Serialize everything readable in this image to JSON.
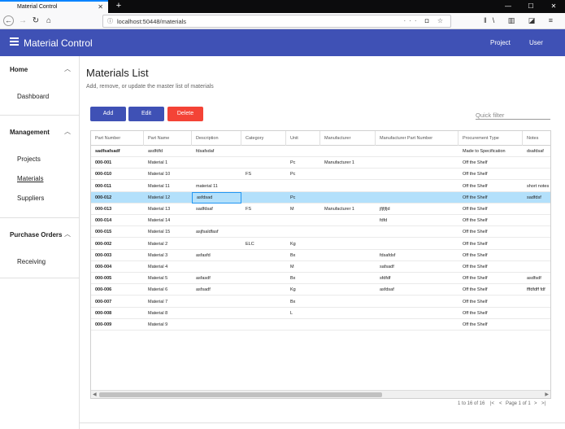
{
  "browser": {
    "tab_title": "Material Control",
    "new_tab": "+",
    "url": "localhost:50448/materials",
    "url_actions": "··· ◘ ☆",
    "toolbar_icons": "‖\\ ▥ ◪ ≡"
  },
  "app": {
    "title": "Material Control",
    "nav": [
      "Project",
      "User"
    ]
  },
  "sidebar": {
    "sections": [
      {
        "title": "Home",
        "items": [
          "Dashboard"
        ]
      },
      {
        "title": "Management",
        "items": [
          "Projects",
          "Materials",
          "Suppliers"
        ]
      },
      {
        "title": "Purchase Orders",
        "items": [
          "Receiving"
        ]
      }
    ]
  },
  "page": {
    "title": "Materials List",
    "subtitle": "Add, remove, or update the master list of materials",
    "buttons": {
      "add": "Add",
      "edit": "Edit",
      "delete": "Delete"
    },
    "quick_filter_placeholder": "Quick filter"
  },
  "grid": {
    "columns": [
      "Part Number",
      "Part Name",
      "Description",
      "Category",
      "Unit",
      "Manufacturer",
      "Manufacturer Part Number",
      "Procurement Type",
      "Notes"
    ],
    "selected_row": 4,
    "focused_cell": [
      4,
      2
    ],
    "rows": [
      [
        "sadfsafsadf",
        "asdfdfd",
        "fdsafsdaf",
        "",
        "",
        "",
        "",
        "Made to Specification",
        "dsafdsaf"
      ],
      [
        "000-001",
        "Material 1",
        "",
        "",
        "Pc",
        "Manufacturer 1",
        "",
        "Off the Shelf",
        ""
      ],
      [
        "000-010",
        "Material 10",
        "",
        "FS",
        "Pc",
        "",
        "",
        "Off the Shelf",
        ""
      ],
      [
        "000-011",
        "Material 11",
        "material 11",
        "",
        "",
        "",
        "",
        "Off the Shelf",
        "short notes"
      ],
      [
        "000-012",
        "Material 12",
        "asfdsad",
        "",
        "Pc",
        "",
        "",
        "Off the Shelf",
        "sadfdsf"
      ],
      [
        "000-013",
        "Material 13",
        "sadfdsaf",
        "FS",
        "M",
        "Manufacturer 1",
        "jfjfjfjd",
        "Off the Shelf",
        ""
      ],
      [
        "000-014",
        "Material 14",
        "",
        "",
        "",
        "",
        "fdfd",
        "Off the Shelf",
        ""
      ],
      [
        "000-015",
        "Material 15",
        "asjfsaldfasf",
        "",
        "",
        "",
        "",
        "Off the Shelf",
        ""
      ],
      [
        "000-002",
        "Material 2",
        "",
        "ELC",
        "Kg",
        "",
        "",
        "Off the Shelf",
        ""
      ],
      [
        "000-003",
        "Material 3",
        "asfasfd",
        "",
        "Bx",
        "",
        "fdsafdsf",
        "Off the Shelf",
        ""
      ],
      [
        "000-004",
        "Material 4",
        "",
        "",
        "M",
        "",
        "safsadf",
        "Off the Shelf",
        ""
      ],
      [
        "000-005",
        "Material 5",
        "asfasdf",
        "",
        "Bx",
        "",
        "sfdfdf",
        "Off the Shelf",
        "asdfsdf"
      ],
      [
        "000-006",
        "Material 6",
        "asfsadf",
        "",
        "Kg",
        "",
        "asfdsaf",
        "Off the Shelf",
        "fffdfdff fdf"
      ],
      [
        "000-007",
        "Material 7",
        "",
        "",
        "Bx",
        "",
        "",
        "Off the Shelf",
        ""
      ],
      [
        "000-008",
        "Material 8",
        "",
        "",
        "L",
        "",
        "",
        "Off the Shelf",
        ""
      ],
      [
        "000-009",
        "Material 9",
        "",
        "",
        "",
        "",
        "",
        "Off the Shelf",
        ""
      ]
    ]
  },
  "pager": {
    "summary": "1 to 16 of 16",
    "first": "|<",
    "prev": "<",
    "page_label": "Page 1 of 1",
    "next": ">",
    "last": ">|"
  }
}
